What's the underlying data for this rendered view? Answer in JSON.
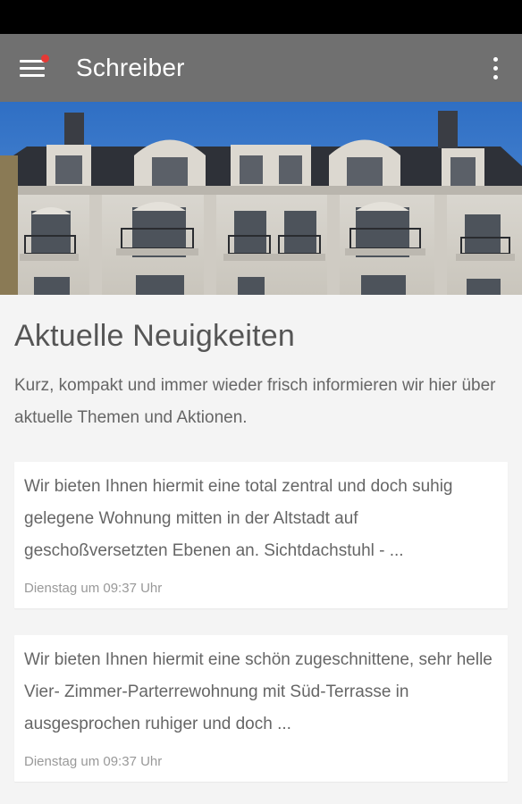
{
  "app_bar": {
    "title": "Schreiber",
    "menu_icon": "hamburger-menu-icon",
    "notification_color": "#e53935",
    "overflow_icon": "more-vertical-icon",
    "background": "#707070"
  },
  "hero": {
    "image": "building-facade-photo"
  },
  "main": {
    "title": "Aktuelle Neuigkeiten",
    "intro": "Kurz, kompakt und immer wieder frisch informieren wir hier über aktuelle Themen und Aktionen."
  },
  "news": [
    {
      "text": "Wir bieten Ihnen hiermit eine total zentral und doch suhig gelegene Wohnung mitten in der Altstadt auf geschoßversetzten Ebenen an. Sichtdachstuhl - ...",
      "date": "Dienstag um 09:37 Uhr"
    },
    {
      "text": "Wir bieten Ihnen hiermit eine schön zugeschnittene, sehr helle Vier- Zimmer-Parterrewohnung mit Süd-Terrasse in ausgesprochen ruhiger und doch ...",
      "date": "Dienstag um 09:37 Uhr"
    }
  ]
}
